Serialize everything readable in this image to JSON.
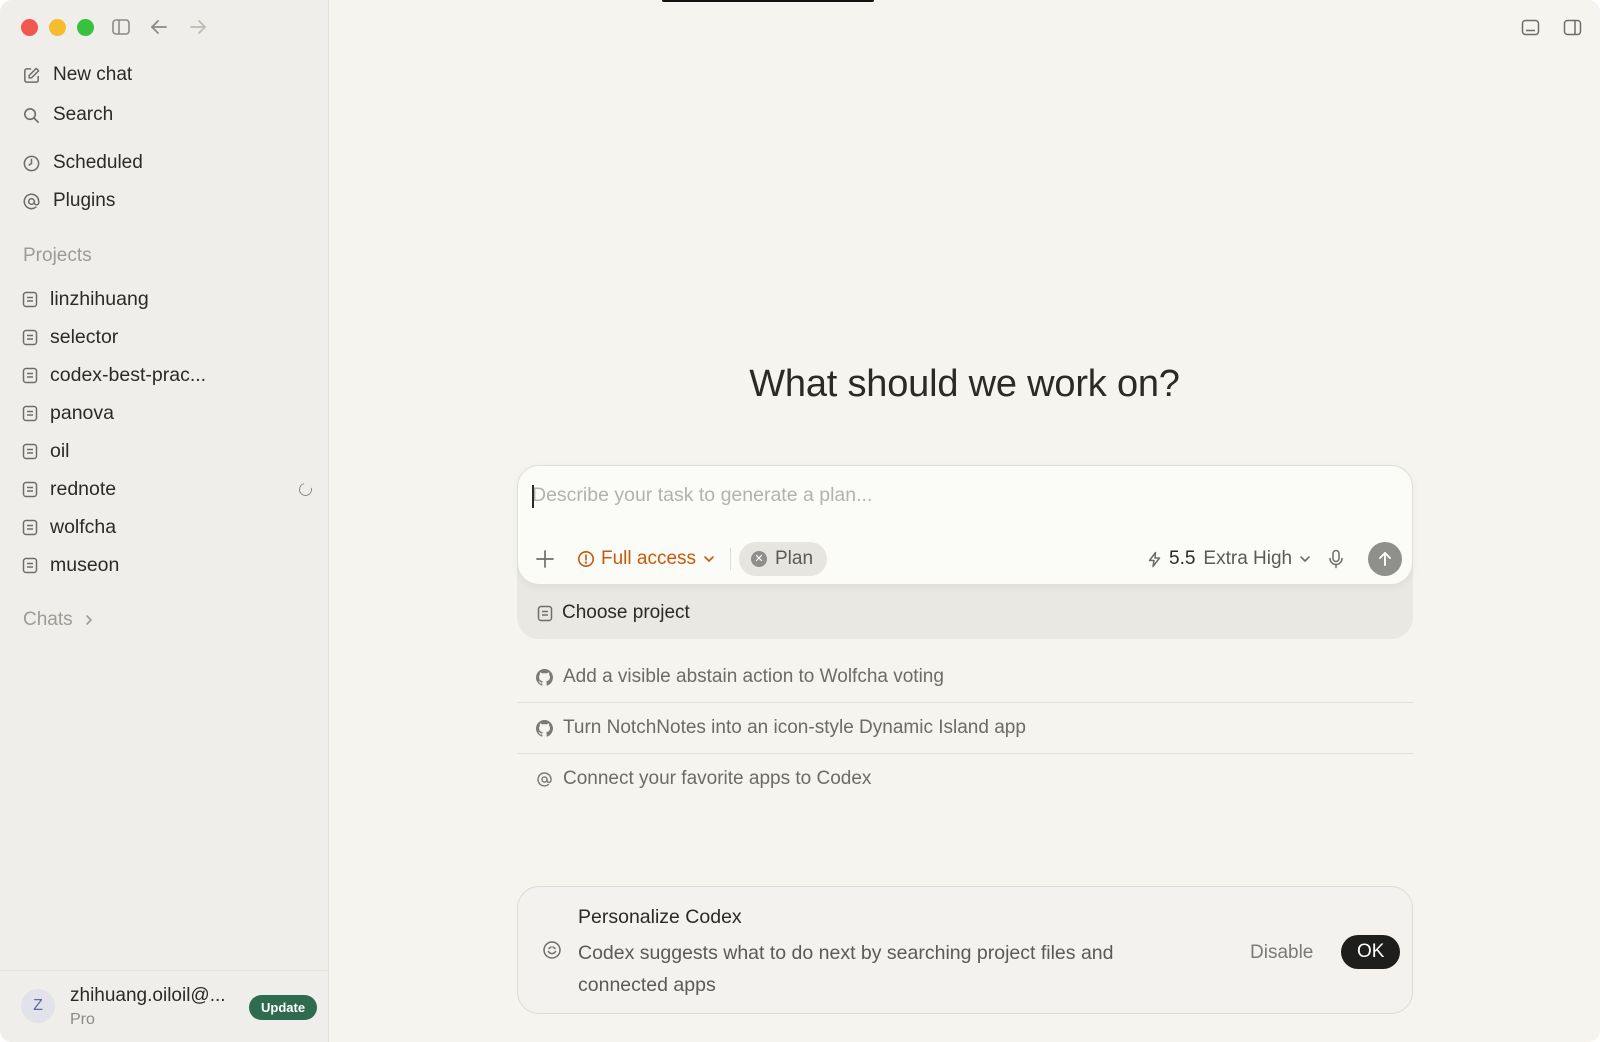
{
  "sidebar": {
    "nav": [
      {
        "label": "New chat",
        "icon": "compose-icon"
      },
      {
        "label": "Search",
        "icon": "search-icon"
      },
      {
        "label": "Scheduled",
        "icon": "clock-icon"
      },
      {
        "label": "Plugins",
        "icon": "at-icon"
      }
    ],
    "projects_label": "Projects",
    "projects": [
      {
        "label": "linzhihuang"
      },
      {
        "label": "selector"
      },
      {
        "label": "codex-best-prac..."
      },
      {
        "label": "panova"
      },
      {
        "label": "oil"
      },
      {
        "label": "rednote",
        "loading": true
      },
      {
        "label": "wolfcha"
      },
      {
        "label": "museon"
      }
    ],
    "chats_label": "Chats",
    "account": {
      "avatar_letter": "Z",
      "email": "zhihuang.oiloil@...",
      "plan": "Pro",
      "update_label": "Update"
    }
  },
  "main": {
    "headline": "What should we work on?",
    "composer": {
      "placeholder": "Describe your task to generate a plan...",
      "value": "",
      "access_label": "Full access",
      "mode_label": "Plan",
      "model_version": "5.5",
      "model_effort": "Extra High"
    },
    "choose_project_label": "Choose project",
    "suggestions": [
      {
        "label": "Add a visible abstain action to Wolfcha voting",
        "icon": "github-icon"
      },
      {
        "label": "Turn NotchNotes into an icon-style Dynamic Island app",
        "icon": "github-icon"
      },
      {
        "label": "Connect your favorite apps to Codex",
        "icon": "at-icon"
      }
    ],
    "personalize": {
      "title": "Personalize Codex",
      "description": "Codex suggests what to do next by searching project files and connected apps",
      "disable_label": "Disable",
      "ok_label": "OK"
    }
  },
  "colors": {
    "accent_warning": "#c8590c",
    "update_badge": "#2f6b4f",
    "ok_button": "#1e1e1d"
  }
}
